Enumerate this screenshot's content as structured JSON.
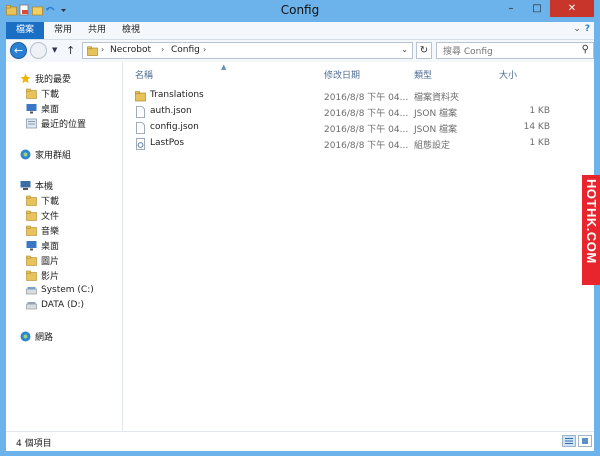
{
  "window": {
    "title": "Config",
    "controls": {
      "minimize": "–",
      "maximize": "□",
      "close": "✕"
    }
  },
  "ribbon": {
    "tabs": [
      {
        "label": "檔案",
        "active": true
      },
      {
        "label": "常用",
        "active": false
      },
      {
        "label": "共用",
        "active": false
      },
      {
        "label": "檢視",
        "active": false
      }
    ]
  },
  "address": {
    "crumbs": [
      "Necrobot",
      "Config"
    ],
    "separator": "›"
  },
  "search": {
    "placeholder": "搜尋 Config"
  },
  "navpane": {
    "items": [
      {
        "label": "我的最愛",
        "icon": "star-icon",
        "level": 0,
        "color": "#f0b400"
      },
      {
        "label": "下載",
        "icon": "download-folder-icon",
        "level": 1,
        "color": "#e8c25a"
      },
      {
        "label": "桌面",
        "icon": "desktop-icon",
        "level": 1,
        "color": "#3a78c6"
      },
      {
        "label": "最近的位置",
        "icon": "recent-places-icon",
        "level": 1,
        "color": "#8a9bb0"
      },
      {
        "label": "家用群組",
        "icon": "homegroup-icon",
        "level": 0,
        "color": "#2f86d0"
      },
      {
        "label": "本機",
        "icon": "computer-icon",
        "level": 0,
        "color": "#3a6ea8"
      },
      {
        "label": "下載",
        "icon": "download-folder-icon",
        "level": 1,
        "color": "#e8c25a"
      },
      {
        "label": "文件",
        "icon": "documents-folder-icon",
        "level": 1,
        "color": "#e8c25a"
      },
      {
        "label": "音樂",
        "icon": "music-folder-icon",
        "level": 1,
        "color": "#e8c25a"
      },
      {
        "label": "桌面",
        "icon": "desktop-icon",
        "level": 1,
        "color": "#3a78c6"
      },
      {
        "label": "圖片",
        "icon": "pictures-folder-icon",
        "level": 1,
        "color": "#e8c25a"
      },
      {
        "label": "影片",
        "icon": "videos-folder-icon",
        "level": 1,
        "color": "#e8c25a"
      },
      {
        "label": "System (C:)",
        "icon": "system-drive-icon",
        "level": 1,
        "color": "#7aa0c8"
      },
      {
        "label": "DATA (D:)",
        "icon": "data-drive-icon",
        "level": 1,
        "color": "#9aa4ae"
      },
      {
        "label": "網路",
        "icon": "network-icon",
        "level": 0,
        "color": "#2f86d0"
      }
    ]
  },
  "columns": {
    "name": "名稱",
    "modified": "修改日期",
    "type": "類型",
    "size": "大小"
  },
  "files": [
    {
      "name": "Translations",
      "modified": "2016/8/8 下午 04...",
      "type": "檔案資料夾",
      "size": "",
      "icon": "folder-icon"
    },
    {
      "name": "auth.json",
      "modified": "2016/8/8 下午 04...",
      "type": "JSON 檔案",
      "size": "1 KB",
      "icon": "file-icon"
    },
    {
      "name": "config.json",
      "modified": "2016/8/8 下午 04...",
      "type": "JSON 檔案",
      "size": "14 KB",
      "icon": "file-icon"
    },
    {
      "name": "LastPos",
      "modified": "2016/8/8 下午 04...",
      "type": "組態設定",
      "size": "1 KB",
      "icon": "config-file-icon"
    }
  ],
  "status": {
    "item_count": "4 個項目"
  },
  "watermark": {
    "text": "HOTHK.COM"
  },
  "colors": {
    "title_bar": "#6cb2eb",
    "file_tab": "#1a6fc4",
    "close_button": "#c7352b",
    "watermark": "#e8242c"
  }
}
